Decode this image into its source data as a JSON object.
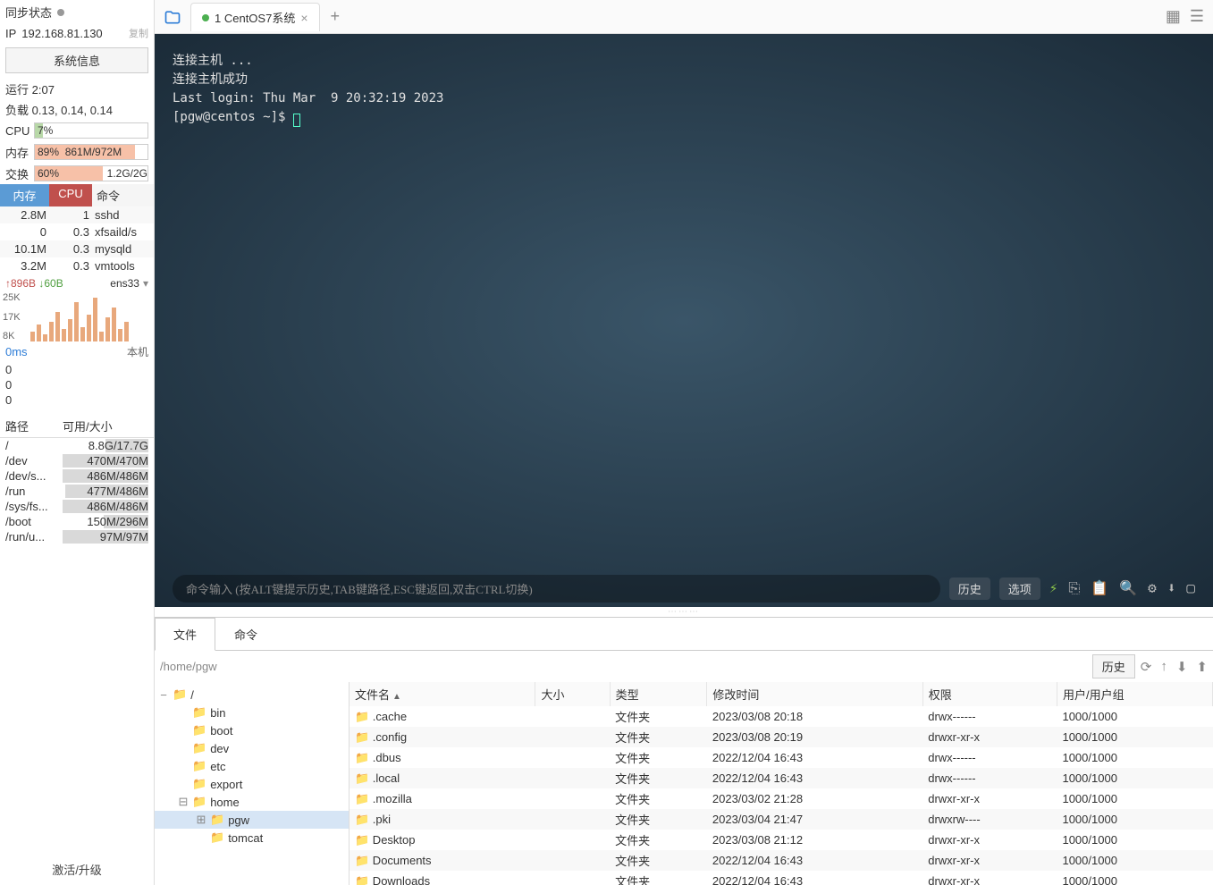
{
  "sidebar": {
    "sync_label": "同步状态",
    "ip_label": "IP",
    "ip_value": "192.168.81.130",
    "copy_label": "复制",
    "sys_info_btn": "系统信息",
    "uptime_label": "运行",
    "uptime_value": "2:07",
    "load_label": "负载",
    "load_value": "0.13, 0.14, 0.14",
    "cpu_label": "CPU",
    "cpu_pct": "7%",
    "mem_label": "内存",
    "mem_pct": "89%",
    "mem_detail": "861M/972M",
    "swap_label": "交换",
    "swap_pct": "60%",
    "swap_detail": "1.2G/2G",
    "proc_headers": {
      "mem": "内存",
      "cpu": "CPU",
      "cmd": "命令"
    },
    "procs": [
      {
        "mem": "2.8M",
        "cpu": "1",
        "cmd": "sshd"
      },
      {
        "mem": "0",
        "cpu": "0.3",
        "cmd": "xfsaild/s"
      },
      {
        "mem": "10.1M",
        "cpu": "0.3",
        "cmd": "mysqld"
      },
      {
        "mem": "3.2M",
        "cpu": "0.3",
        "cmd": "vmtools"
      }
    ],
    "net_up": "↑896B",
    "net_down": "↓60B",
    "net_if": "ens33",
    "net_ylabels": [
      "25K",
      "17K",
      "8K"
    ],
    "latency_ms": "0ms",
    "latency_host": "本机",
    "latency_vals": [
      "0",
      "0",
      "0"
    ],
    "disk_headers": {
      "path": "路径",
      "size": "可用/大小"
    },
    "disks": [
      {
        "path": "/",
        "size": "8.8G/17.7G",
        "pct": 50
      },
      {
        "path": "/dev",
        "size": "470M/470M",
        "pct": 100
      },
      {
        "path": "/dev/s...",
        "size": "486M/486M",
        "pct": 100
      },
      {
        "path": "/run",
        "size": "477M/486M",
        "pct": 97
      },
      {
        "path": "/sys/fs...",
        "size": "486M/486M",
        "pct": 100
      },
      {
        "path": "/boot",
        "size": "150M/296M",
        "pct": 52
      },
      {
        "path": "/run/u...",
        "size": "97M/97M",
        "pct": 100
      }
    ],
    "activate": "激活/升级"
  },
  "tabs": {
    "active": "1 CentOS7系统"
  },
  "terminal": {
    "lines": [
      "连接主机 ...",
      "连接主机成功",
      "Last login: Thu Mar  9 20:32:19 2023",
      "[pgw@centos ~]$ "
    ],
    "cmd_placeholder": "命令输入 (按ALT键提示历史,TAB键路径,ESC键返回,双击CTRL切换)",
    "history_btn": "历史",
    "options_btn": "选项"
  },
  "filepanel": {
    "tab_file": "文件",
    "tab_cmd": "命令",
    "path": "/home/pgw",
    "history_btn": "历史",
    "tree": [
      {
        "level": 0,
        "name": "/",
        "exp": "−"
      },
      {
        "level": 1,
        "name": "bin"
      },
      {
        "level": 1,
        "name": "boot"
      },
      {
        "level": 1,
        "name": "dev"
      },
      {
        "level": 1,
        "name": "etc"
      },
      {
        "level": 1,
        "name": "export"
      },
      {
        "level": 1,
        "name": "home",
        "exp": "⊟"
      },
      {
        "level": 2,
        "name": "pgw",
        "exp": "⊞",
        "sel": true
      },
      {
        "level": 2,
        "name": "tomcat"
      }
    ],
    "cols": {
      "name": "文件名",
      "size": "大小",
      "type": "类型",
      "mtime": "修改时间",
      "perm": "权限",
      "owner": "用户/用户组"
    },
    "rows": [
      {
        "name": ".cache",
        "size": "",
        "type": "文件夹",
        "mtime": "2023/03/08 20:18",
        "perm": "drwx------",
        "owner": "1000/1000"
      },
      {
        "name": ".config",
        "size": "",
        "type": "文件夹",
        "mtime": "2023/03/08 20:19",
        "perm": "drwxr-xr-x",
        "owner": "1000/1000"
      },
      {
        "name": ".dbus",
        "size": "",
        "type": "文件夹",
        "mtime": "2022/12/04 16:43",
        "perm": "drwx------",
        "owner": "1000/1000"
      },
      {
        "name": ".local",
        "size": "",
        "type": "文件夹",
        "mtime": "2022/12/04 16:43",
        "perm": "drwx------",
        "owner": "1000/1000"
      },
      {
        "name": ".mozilla",
        "size": "",
        "type": "文件夹",
        "mtime": "2023/03/02 21:28",
        "perm": "drwxr-xr-x",
        "owner": "1000/1000"
      },
      {
        "name": ".pki",
        "size": "",
        "type": "文件夹",
        "mtime": "2023/03/04 21:47",
        "perm": "drwxrw----",
        "owner": "1000/1000"
      },
      {
        "name": "Desktop",
        "size": "",
        "type": "文件夹",
        "mtime": "2023/03/08 21:12",
        "perm": "drwxr-xr-x",
        "owner": "1000/1000"
      },
      {
        "name": "Documents",
        "size": "",
        "type": "文件夹",
        "mtime": "2022/12/04 16:43",
        "perm": "drwxr-xr-x",
        "owner": "1000/1000"
      },
      {
        "name": "Downloads",
        "size": "",
        "type": "文件夹",
        "mtime": "2022/12/04 16:43",
        "perm": "drwxr-xr-x",
        "owner": "1000/1000"
      }
    ]
  }
}
